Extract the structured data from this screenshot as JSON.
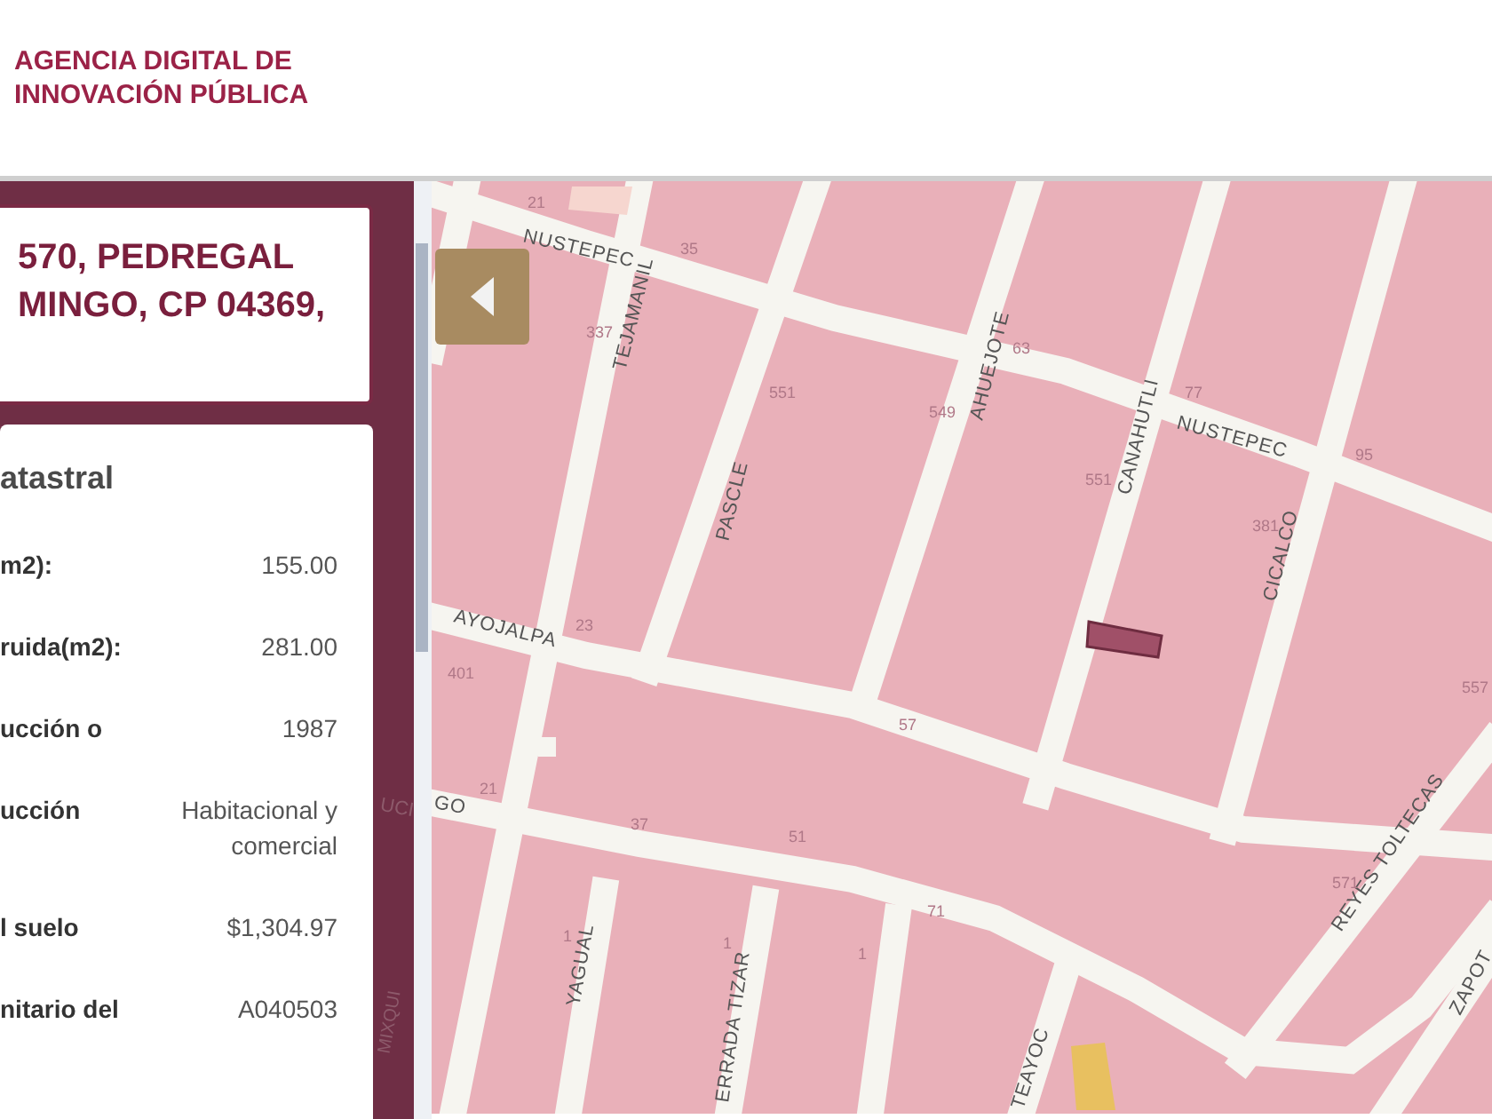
{
  "header": {
    "logo_lines": [
      "AGENCIA DIGITAL DE",
      "INNOVACIÓN PÚBLICA"
    ]
  },
  "address_card": {
    "lines": [
      "570, PEDREGAL",
      "MINGO, CP 04369,"
    ]
  },
  "info_card": {
    "title": "atastral",
    "rows": [
      {
        "label": "m2):",
        "value": "155.00"
      },
      {
        "label": "ruida(m2):",
        "value": "281.00"
      },
      {
        "label": "ucción o",
        "value": "1987"
      },
      {
        "label": "ucción",
        "value": "Habitacional y comercial"
      },
      {
        "label": "l suelo",
        "value": "$1,304.97"
      },
      {
        "label": "nitario del",
        "value": "A040503"
      }
    ]
  },
  "sidebar_map_labels": [
    "UCI",
    "MIXQUI"
  ],
  "map": {
    "street_labels": [
      "NUSTEPEC",
      "TEJAMANIL",
      "AHUEJOTE",
      "PASCLE",
      "CANAHUTLI",
      "NUSTEPEC",
      "CICALCO",
      "AYOJALPA",
      "REYES TOLTECAS",
      "YAGUAL",
      "ERRADA TIZAR",
      "TEAYOC",
      "ZAPOT",
      "GO"
    ],
    "number_labels": [
      "21",
      "35",
      "337",
      "551",
      "549",
      "63",
      "77",
      "551",
      "95",
      "381",
      "23",
      "401",
      "57",
      "557",
      "21",
      "37",
      "51",
      "71",
      "571",
      "1",
      "1",
      "1"
    ]
  }
}
